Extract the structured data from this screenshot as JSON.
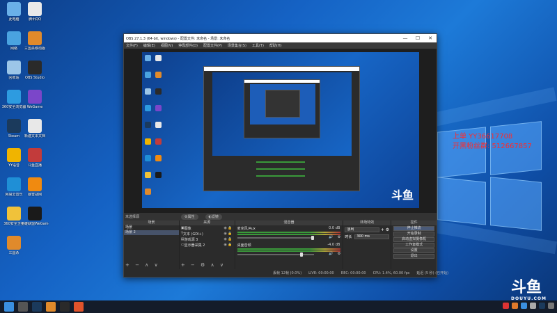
{
  "desktop": {
    "icons": [
      {
        "label": "此电脑",
        "color": "#6ab0e8"
      },
      {
        "label": "腾讯QQ",
        "color": "#e9e9e9"
      },
      {
        "label": "网络",
        "color": "#4aa3e0"
      },
      {
        "label": "三国杀移动版",
        "color": "#e08a2b"
      },
      {
        "label": "回收站",
        "color": "#9cc6e8"
      },
      {
        "label": "OBS Studio",
        "color": "#2a2a2a"
      },
      {
        "label": "360安全浏览器",
        "color": "#2d9be0"
      },
      {
        "label": "WeGame",
        "color": "#7b46c9"
      },
      {
        "label": "Steam",
        "color": "#1b3a5c"
      },
      {
        "label": "新建文本文档",
        "color": "#e8e8e8"
      },
      {
        "label": "YY语音",
        "color": "#f0b400"
      },
      {
        "label": "斗鱼直播",
        "color": "#c23b3b"
      },
      {
        "label": "网易云音乐",
        "color": "#1f8fd6"
      },
      {
        "label": "暴雪战网",
        "color": "#f08a10"
      },
      {
        "label": "360安全卫士",
        "color": "#f0c23a"
      },
      {
        "label": "英雄联盟WeGame版",
        "color": "#1a1a1a"
      },
      {
        "label": "三国杀",
        "color": "#e08a2b"
      }
    ],
    "overlay_lines": [
      "上单 YY36617708",
      "开黑粉丝群: 512667857"
    ],
    "watermark": "斗鱼",
    "watermark_sub": "DOUYU.COM"
  },
  "obs": {
    "title": "OBS 27.1.3 (64-bit, windows) - 配置文件: 未命名 - 场景: 未命名",
    "menu": [
      "文件(F)",
      "编辑(E)",
      "视图(V)",
      "停靠部件(D)",
      "配置文件(P)",
      "场景集合(S)",
      "工具(T)",
      "帮助(H)"
    ],
    "window_buttons": [
      "—",
      "☐",
      "✕"
    ],
    "scene_bar": {
      "no_source": "未选择源",
      "properties": "属性",
      "filters": "滤镜"
    },
    "docks": {
      "scenes": {
        "header": "场景",
        "items": [
          "场景",
          "场景 2"
        ]
      },
      "sources": {
        "header": "来源",
        "items": [
          "图像",
          "文本 (GDI+)",
          "游戏源 3",
          "显示器采集 2"
        ]
      },
      "mixer": {
        "header": "混音器",
        "channels": [
          {
            "name": "麦克风/Aux",
            "db": "0.0 dB"
          },
          {
            "name": "桌面音频",
            "db": "-4.0 dB"
          }
        ]
      },
      "transitions": {
        "header": "转场特效",
        "type": "淡出",
        "duration_label": "时长",
        "duration_value": "300 ms"
      },
      "controls": {
        "header": "控件",
        "buttons": [
          "停止推流",
          "开始录制",
          "启动虚拟摄像机",
          "工作室模式",
          "设置",
          "退出"
        ]
      }
    },
    "status": {
      "dropped": "丢帧 12帧 (0.0%)",
      "live": "LIVE: 00:00:00",
      "rec": "REC: 00:00:00",
      "cpu": "CPU: 1.4%, 60.00 fps",
      "delay": "延迟 (5 秒) (已开始)"
    }
  },
  "taskbar": {
    "icons": [
      {
        "name": "start",
        "color": "#3a8fe0"
      },
      {
        "name": "search",
        "color": "#555"
      },
      {
        "name": "steam",
        "color": "#1b3a5c"
      },
      {
        "name": "three-kingdoms",
        "color": "#e08a2b"
      },
      {
        "name": "obs",
        "color": "#2a2a2a"
      },
      {
        "name": "douyu",
        "color": "#e0532b"
      }
    ],
    "tray_colors": [
      "#d33",
      "#e07a2b",
      "#3a8fe0",
      "#aaa",
      "#1b3a5c",
      "#777"
    ]
  }
}
